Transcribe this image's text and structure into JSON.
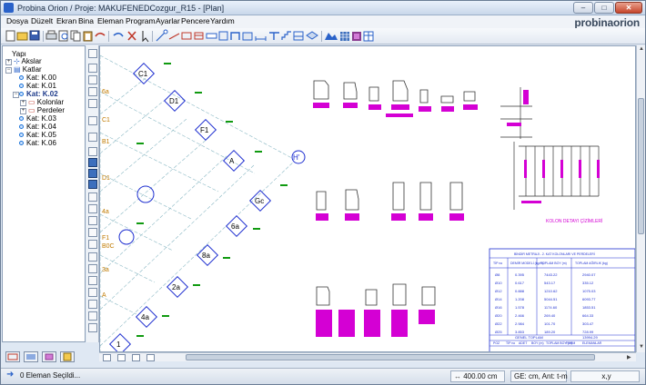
{
  "window": {
    "title": "Probina Orion / Proje: MAKUFENEDCozgur_R15 - [Plan]",
    "buttons": {
      "minimize": "–",
      "maximize": "□",
      "close": "✕"
    }
  },
  "brand": "probinaorion",
  "menu": [
    "Dosya",
    "Düzelt",
    "Ekran",
    "Bina",
    "Eleman",
    "Program",
    "Ayarlar",
    "Pencere",
    "Yardım"
  ],
  "toolbar_icons": [
    "new-file-icon",
    "open-folder-icon",
    "save-icon",
    "print-icon",
    "print-preview-icon",
    "copy-icon",
    "paste-icon",
    "undo-icon",
    "redo-icon",
    "delete-icon",
    "select-icon",
    "axis-icon",
    "line-icon",
    "rectangle-icon",
    "column-icon",
    "beam-icon",
    "slab-icon",
    "wall-icon",
    "foundation-icon",
    "dimension-icon",
    "text-icon",
    "stair-icon",
    "section-icon",
    "view-3d-icon",
    "render-icon",
    "grid-icon",
    "layers-icon",
    "table-icon"
  ],
  "tree": {
    "root": "Yapı",
    "items": [
      {
        "label": "Akslar",
        "level": 1
      },
      {
        "label": "Katlar",
        "level": 1
      },
      {
        "label": "Kat: K.00",
        "level": 2
      },
      {
        "label": "Kat: K.01",
        "level": 2
      },
      {
        "label": "Kat: K.02",
        "level": 2,
        "selected": true
      },
      {
        "label": "Kolonlar",
        "level": 3
      },
      {
        "label": "Perdeler",
        "level": 3
      },
      {
        "label": "Kat: K.03",
        "level": 2
      },
      {
        "label": "Kat: K.04",
        "level": 2
      },
      {
        "label": "Kat: K.05",
        "level": 2
      },
      {
        "label": "Kat: K.06",
        "level": 2
      }
    ]
  },
  "plan": {
    "column_labels": [
      "C1",
      "D1",
      "F1",
      "A",
      "Gc",
      "6a",
      "8a",
      "2a",
      "4a",
      "1"
    ],
    "axis_labels": [
      "6a",
      "C1",
      "B1",
      "D1",
      "4a",
      "F1",
      "B0C",
      "3a",
      "A"
    ],
    "axis_circle": "H'",
    "table": {
      "title": "BİNDİR METRAJI - 2. KAT KOLONLARI VE PERDELERİ",
      "headers": [
        "TİP no",
        "DEMİR MODELİ (kg/m)",
        "TOPLAM BOY (m)",
        "TOPLAM AĞIRLIK (kg)"
      ],
      "rows": [
        [
          "Ø8",
          "0.395",
          "7443.22",
          "2940.07"
        ],
        [
          "Ø10",
          "0.617",
          "543.17",
          "335.12"
        ],
        [
          "Ø12",
          "0.888",
          "1210.62",
          "1075.03"
        ],
        [
          "Ø14",
          "1.208",
          "5044.51",
          "6093.77"
        ],
        [
          "Ø16",
          "1.578",
          "1174.60",
          "1853.51"
        ],
        [
          "Ø20",
          "2.466",
          "269.40",
          "664.33"
        ],
        [
          "Ø22",
          "2.984",
          "101.70",
          "303.47"
        ],
        [
          "Ø25",
          "3.853",
          "189.20",
          "728.99"
        ]
      ],
      "total_label": "GENEL TOPLAM",
      "total_value": "13994.29",
      "footer": [
        "POZ",
        "TİP no",
        "ADET",
        "BOY (m)",
        "TOPLAM BOY (m)",
        "FORM",
        "ELEMANLAR"
      ]
    },
    "section_caption": "KOLON DETAYI ÇİZİMLERİ"
  },
  "status": {
    "selection": "0 Eleman Seçildi...",
    "grid": "400.00 cm",
    "units": "GE: cm, Ant: t-m",
    "coords": "x,y"
  },
  "colors": {
    "magenta": "#d400d4",
    "green": "#109a10",
    "blue": "#1e2fd0",
    "cyan": "#2aa6b8",
    "olive": "#c07a00"
  }
}
